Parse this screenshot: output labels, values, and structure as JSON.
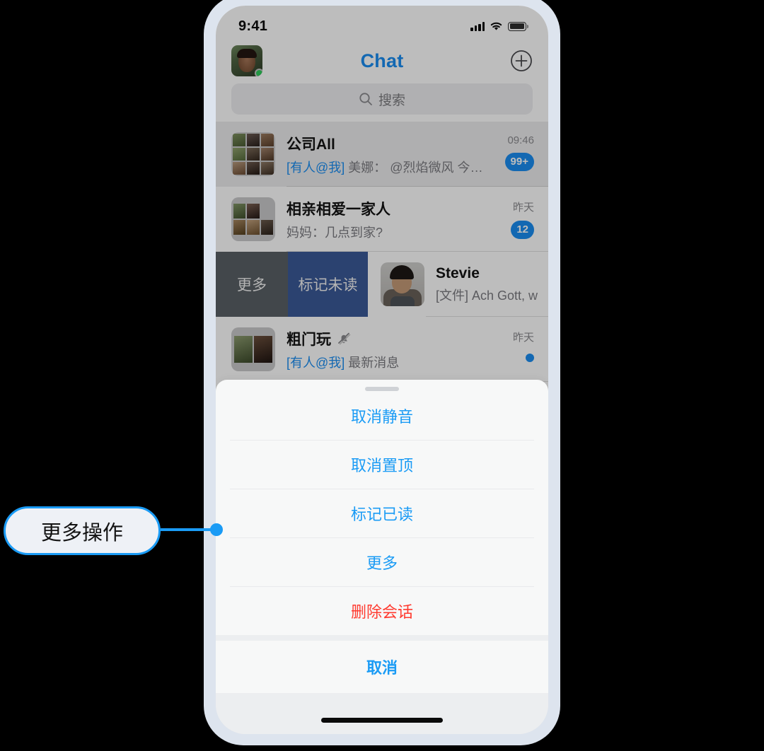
{
  "status_bar": {
    "time": "9:41",
    "cellular_icon": "signal-bars-icon",
    "wifi_icon": "wifi-icon",
    "battery_icon": "battery-icon"
  },
  "nav_bar": {
    "title": "Chat",
    "avatar_icon": "user-avatar",
    "online_indicator": "online-status-dot",
    "add_icon": "plus-circle-icon"
  },
  "search": {
    "placeholder": "搜索",
    "icon": "search-icon"
  },
  "chat_list": [
    {
      "name": "公司All",
      "preview_mention": "[有人@我]",
      "preview": " 美娜： @烈焰微风 今天能给...",
      "time": "09:46",
      "badge": "99+",
      "pinned": true,
      "avatar_icon": "group-avatar-9"
    },
    {
      "name": "相亲相爱一家人",
      "preview_mention": "",
      "preview": "妈妈：几点到家?",
      "time": "昨天",
      "badge": "12",
      "pinned": false,
      "avatar_icon": "group-avatar-5"
    }
  ],
  "swipe_row": {
    "actions": [
      {
        "label": "更多",
        "color": "#5a6166",
        "name": "swipe-action-more"
      },
      {
        "label": "标记未读",
        "color": "#3b5998",
        "name": "swipe-action-mark-unread"
      }
    ],
    "chat": {
      "name": "Stevie",
      "preview_tag": "[文件]",
      "preview": " Ach Gott, w",
      "avatar_icon": "user-avatar-stevie"
    }
  },
  "chat_list_bottom": [
    {
      "name": "粗门玩",
      "muted_icon": "bell-muted-icon",
      "preview_mention": "[有人@我]",
      "preview": " 最新消息",
      "time": "昨天",
      "unread_dot": true,
      "avatar_icon": "group-avatar-2"
    }
  ],
  "action_sheet": {
    "handle": "drag-handle",
    "items": [
      {
        "label": "取消静音",
        "style": "default",
        "name": "sheet-item-unmute"
      },
      {
        "label": "取消置顶",
        "style": "default",
        "name": "sheet-item-unpin"
      },
      {
        "label": "标记已读",
        "style": "default",
        "name": "sheet-item-mark-read"
      },
      {
        "label": "更多",
        "style": "default",
        "name": "sheet-item-more"
      },
      {
        "label": "删除会话",
        "style": "danger",
        "name": "sheet-item-delete"
      }
    ],
    "cancel_label": "取消"
  },
  "callout": {
    "label": "更多操作"
  },
  "colors": {
    "accent_blue": "#1a8df0",
    "sheet_blue": "#1a9bf5",
    "danger_red": "#ff3b30",
    "badge_blue": "#1a8df0",
    "swipe_more": "#5a6166",
    "swipe_unread": "#3b5998",
    "online_green": "#2ecc5b",
    "frame": "#dde4ee",
    "background": "#000000"
  }
}
